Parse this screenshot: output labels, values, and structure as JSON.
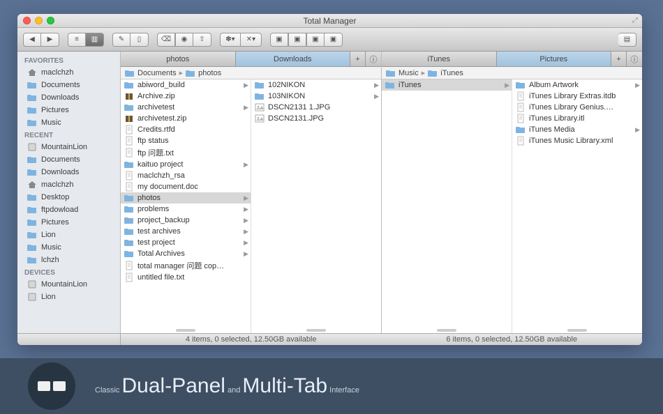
{
  "window": {
    "title": "Total Manager"
  },
  "sidebar": {
    "sections": [
      {
        "head": "FAVORITES",
        "items": [
          {
            "icon": "home",
            "label": "maclchzh"
          },
          {
            "icon": "folder",
            "label": "Documents"
          },
          {
            "icon": "folder",
            "label": "Downloads"
          },
          {
            "icon": "folder",
            "label": "Pictures"
          },
          {
            "icon": "folder",
            "label": "Music"
          }
        ]
      },
      {
        "head": "RECENT",
        "items": [
          {
            "icon": "disk",
            "label": "MountainLion"
          },
          {
            "icon": "folder",
            "label": "Documents"
          },
          {
            "icon": "folder",
            "label": "Downloads"
          },
          {
            "icon": "home",
            "label": "maclchzh"
          },
          {
            "icon": "folder",
            "label": "Desktop"
          },
          {
            "icon": "folder",
            "label": "ftpdowload"
          },
          {
            "icon": "folder",
            "label": "Pictures"
          },
          {
            "icon": "folder",
            "label": "Lion"
          },
          {
            "icon": "folder",
            "label": "Music"
          },
          {
            "icon": "folder",
            "label": "lchzh"
          }
        ]
      },
      {
        "head": "DEVICES",
        "items": [
          {
            "icon": "disk",
            "label": "MountainLion"
          },
          {
            "icon": "disk",
            "label": "Lion"
          }
        ]
      }
    ]
  },
  "left": {
    "tabs": [
      {
        "label": "photos",
        "sel": false
      },
      {
        "label": "Downloads",
        "sel": true
      }
    ],
    "crumbs": [
      "Documents",
      "photos"
    ],
    "cols": [
      [
        {
          "icon": "folder",
          "label": "abiword_build",
          "arr": true
        },
        {
          "icon": "archive",
          "label": "Archive.zip"
        },
        {
          "icon": "folder",
          "label": "archivetest",
          "arr": true
        },
        {
          "icon": "archive",
          "label": "archivetest.zip"
        },
        {
          "icon": "doc",
          "label": "Credits.rtfd"
        },
        {
          "icon": "doc",
          "label": "ftp status"
        },
        {
          "icon": "doc",
          "label": "ftp 问题.txt"
        },
        {
          "icon": "folder",
          "label": "kaituo project",
          "arr": true
        },
        {
          "icon": "doc",
          "label": "maclchzh_rsa"
        },
        {
          "icon": "doc",
          "label": "my document.doc"
        },
        {
          "icon": "folder",
          "label": "photos",
          "arr": true,
          "sel": true
        },
        {
          "icon": "folder",
          "label": "problems",
          "arr": true
        },
        {
          "icon": "folder",
          "label": "project_backup",
          "arr": true
        },
        {
          "icon": "folder",
          "label": "test archives",
          "arr": true
        },
        {
          "icon": "folder",
          "label": "test project",
          "arr": true
        },
        {
          "icon": "folder",
          "label": "Total Archives",
          "arr": true
        },
        {
          "icon": "doc",
          "label": "total manager 问题 cop…"
        },
        {
          "icon": "doc",
          "label": "untitled file.txt"
        }
      ],
      [
        {
          "icon": "folder",
          "label": "102NIKON",
          "arr": true
        },
        {
          "icon": "folder",
          "label": "103NIKON",
          "arr": true
        },
        {
          "icon": "img",
          "label": "DSCN2131 1.JPG"
        },
        {
          "icon": "img",
          "label": "DSCN2131.JPG"
        }
      ]
    ],
    "status": "4 items, 0 selected, 12.50GB available"
  },
  "right": {
    "tabs": [
      {
        "label": "iTunes",
        "sel": false
      },
      {
        "label": "Pictures",
        "sel": true
      }
    ],
    "crumbs": [
      "Music",
      "iTunes"
    ],
    "cols": [
      [
        {
          "icon": "folder",
          "label": "iTunes",
          "arr": true,
          "sel": true
        }
      ],
      [
        {
          "icon": "folder",
          "label": "Album Artwork",
          "arr": true
        },
        {
          "icon": "doc",
          "label": "iTunes Library Extras.itdb"
        },
        {
          "icon": "doc",
          "label": "iTunes Library Genius.…"
        },
        {
          "icon": "doc",
          "label": "iTunes Library.itl"
        },
        {
          "icon": "folder",
          "label": "iTunes Media",
          "arr": true
        },
        {
          "icon": "doc",
          "label": "iTunes Music Library.xml"
        }
      ]
    ],
    "status": "6 items, 0 selected, 12.50GB available"
  },
  "caption": {
    "t1": "Classic ",
    "t2": "Dual-Panel",
    "t3": " and ",
    "t4": "Multi-Tab",
    "t5": " Interface"
  }
}
